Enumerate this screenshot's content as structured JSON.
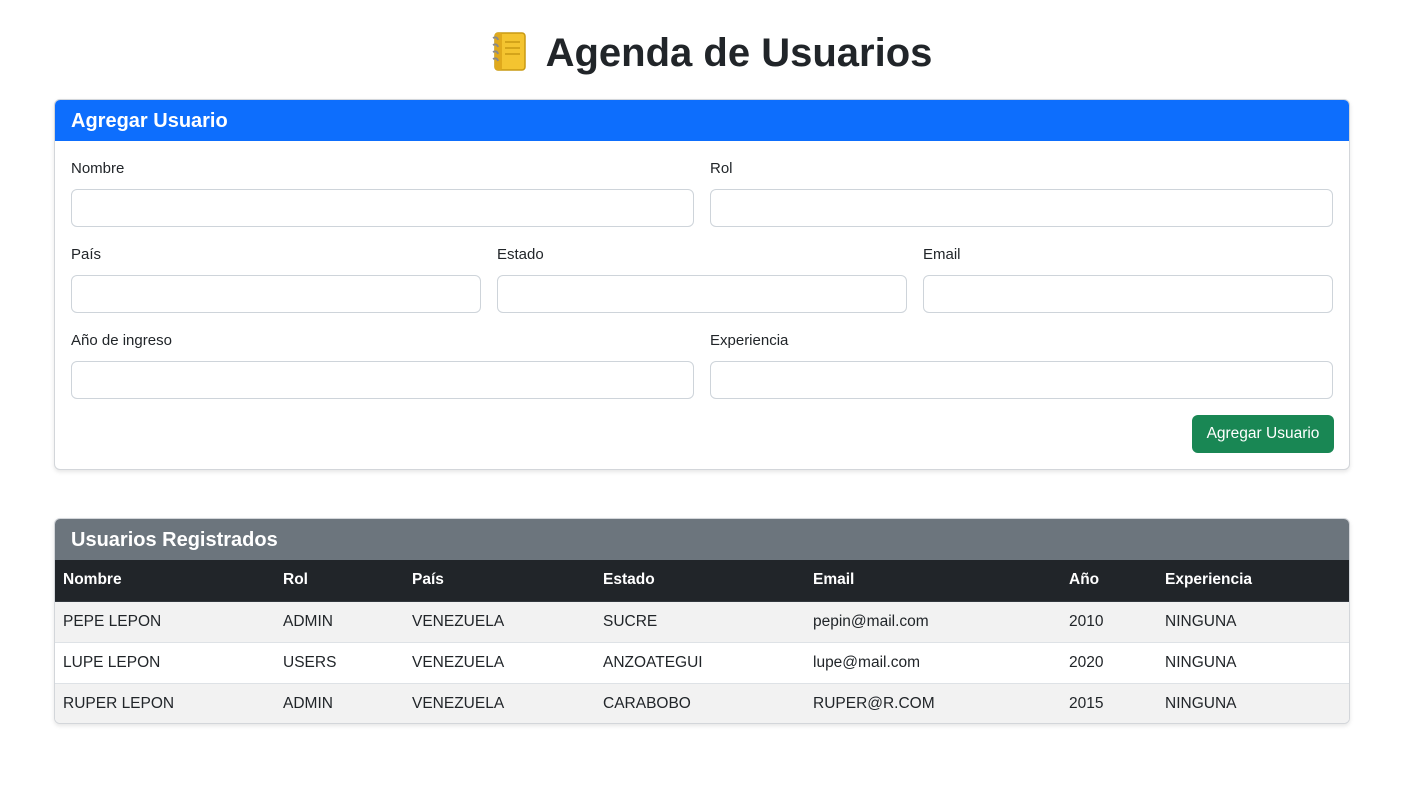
{
  "header": {
    "title": "Agenda de Usuarios",
    "icon": "notebook-icon"
  },
  "form": {
    "title": "Agregar Usuario",
    "fields": {
      "nombre": {
        "label": "Nombre",
        "value": "",
        "placeholder": ""
      },
      "rol": {
        "label": "Rol",
        "value": "",
        "placeholder": ""
      },
      "pais": {
        "label": "País",
        "value": "",
        "placeholder": ""
      },
      "estado": {
        "label": "Estado",
        "value": "",
        "placeholder": ""
      },
      "email": {
        "label": "Email",
        "value": "",
        "placeholder": ""
      },
      "anio": {
        "label": "Año de ingreso",
        "value": "",
        "placeholder": ""
      },
      "experiencia": {
        "label": "Experiencia",
        "value": "",
        "placeholder": ""
      }
    },
    "submit_label": "Agregar Usuario"
  },
  "table": {
    "title": "Usuarios Registrados",
    "columns": [
      "Nombre",
      "Rol",
      "País",
      "Estado",
      "Email",
      "Año",
      "Experiencia"
    ],
    "rows": [
      [
        "PEPE LEPON",
        "ADMIN",
        "VENEZUELA",
        "SUCRE",
        "pepin@mail.com",
        "2010",
        "NINGUNA"
      ],
      [
        "LUPE LEPON",
        "USERS",
        "VENEZUELA",
        "ANZOATEGUI",
        "lupe@mail.com",
        "2020",
        "NINGUNA"
      ],
      [
        "RUPER LEPON",
        "ADMIN",
        "VENEZUELA",
        "CARABOBO",
        "RUPER@R.COM",
        "2015",
        "NINGUNA"
      ]
    ]
  },
  "colors": {
    "primary": "#0d6efd",
    "secondary": "#6c757d",
    "success": "#198754",
    "dark": "#212529"
  }
}
